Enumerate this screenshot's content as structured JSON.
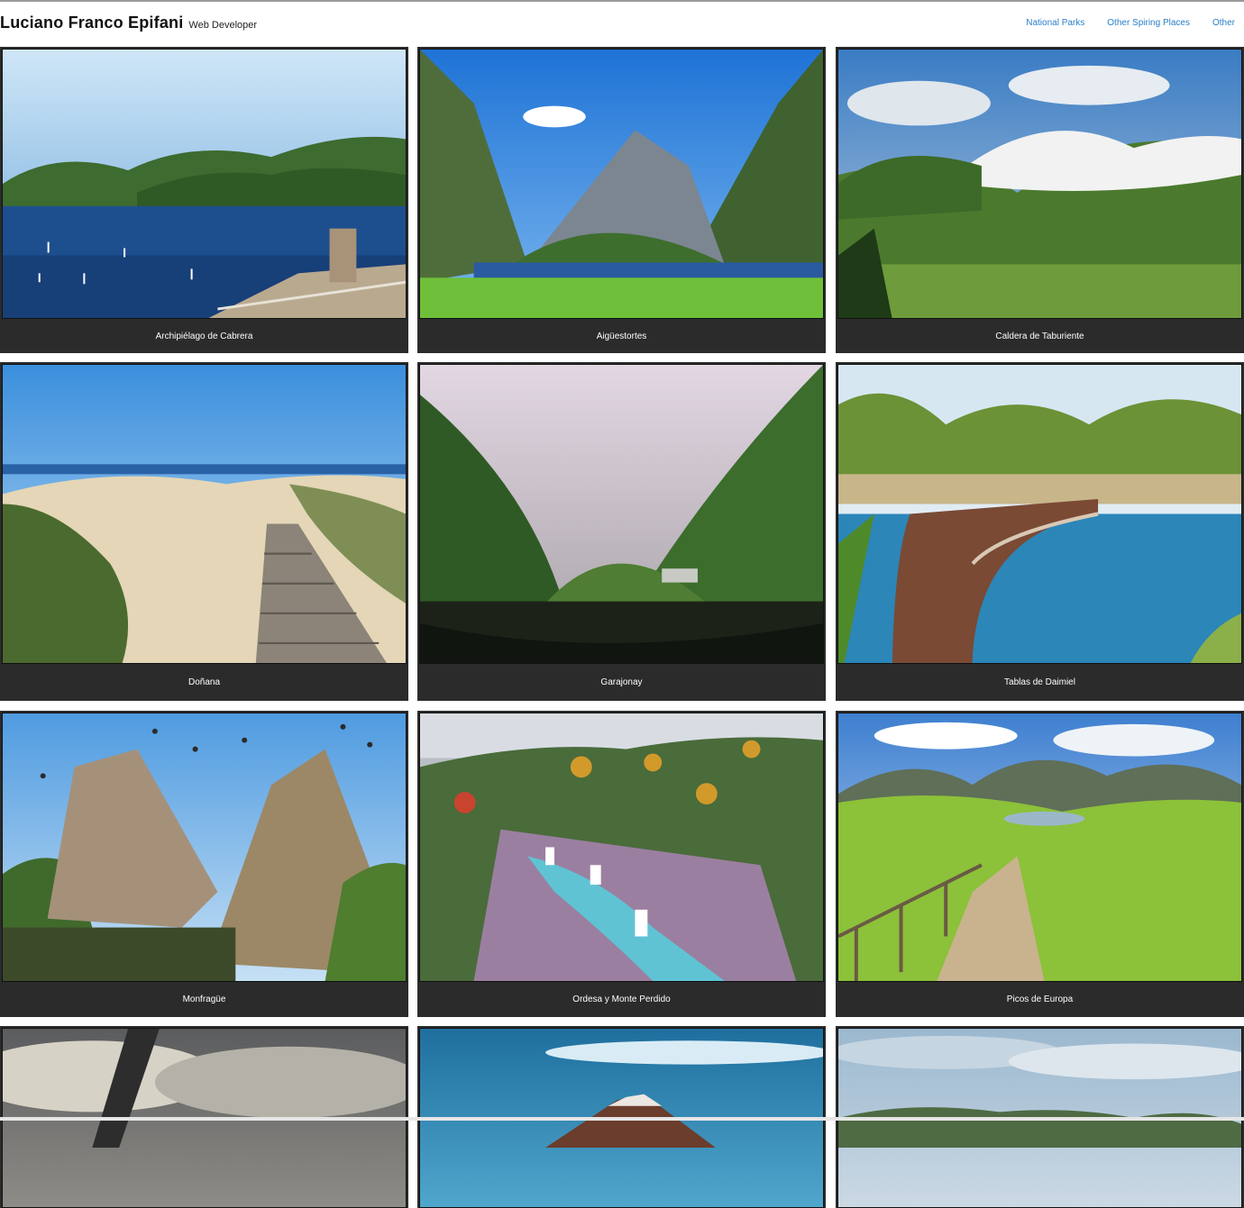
{
  "header": {
    "name": "Luciano Franco Epifani",
    "role": "Web Developer",
    "nav": [
      "National Parks",
      "Other Spiring Places",
      "Other"
    ]
  },
  "gallery": {
    "cards": [
      {
        "caption": "Archipiélago de Cabrera",
        "scene": "sea"
      },
      {
        "caption": "Aigüestortes",
        "scene": "valley-lake"
      },
      {
        "caption": "Caldera de Taburiente",
        "scene": "clouds-mountains"
      },
      {
        "caption": "Doñana",
        "scene": "dunes-boardwalk"
      },
      {
        "caption": "Garajonay",
        "scene": "foggy-lake"
      },
      {
        "caption": "Tablas de Daimiel",
        "scene": "wetland-boardwalk"
      },
      {
        "caption": "Monfragüe",
        "scene": "rocky-river"
      },
      {
        "caption": "Ordesa y Monte Perdido",
        "scene": "autumn-waterfalls"
      },
      {
        "caption": "Picos de Europa",
        "scene": "meadow-path"
      },
      {
        "caption": "",
        "scene": "stormy-sky"
      },
      {
        "caption": "",
        "scene": "volcano"
      },
      {
        "caption": "",
        "scene": "hills-sky"
      }
    ]
  },
  "colors": {
    "nav_link": "#2a7fc8",
    "caption_bar": "#2b2b2b",
    "caption_text": "#ffffff"
  }
}
